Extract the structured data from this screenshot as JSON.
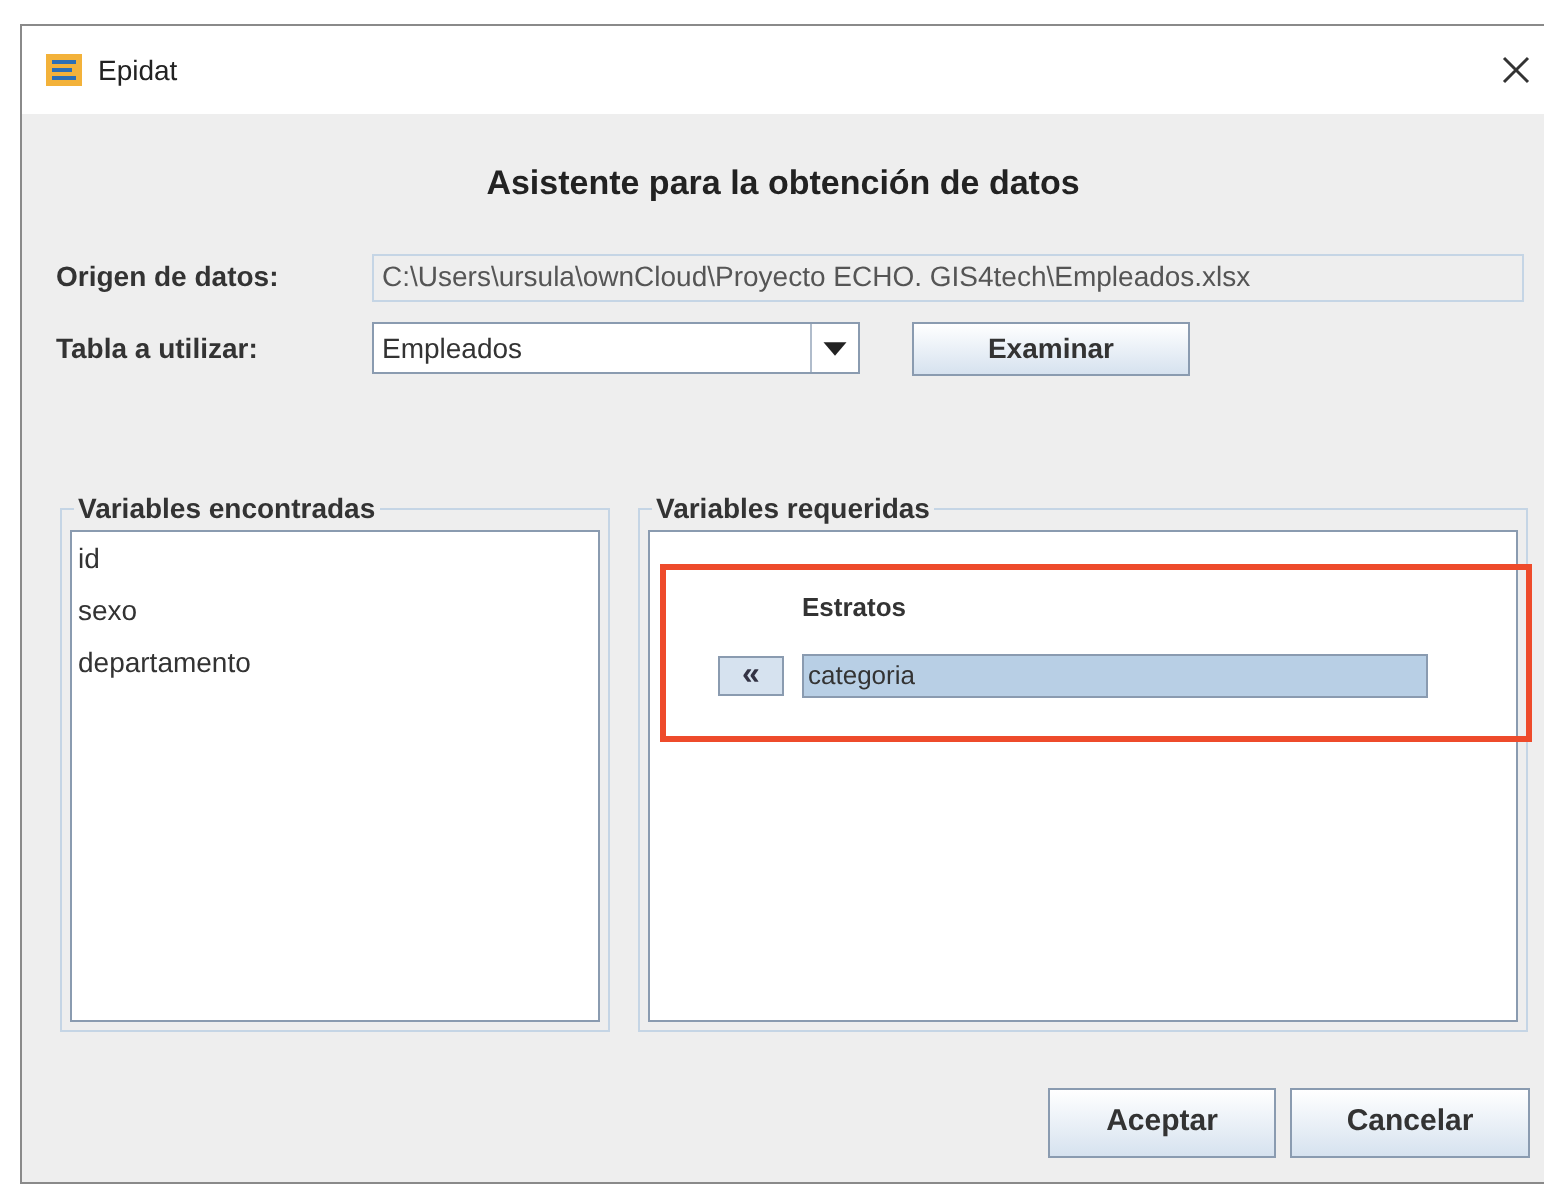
{
  "window": {
    "title": "Epidat"
  },
  "heading": "Asistente para la obtención de datos",
  "origin": {
    "label": "Origen de datos:",
    "value": "C:\\Users\\ursula\\ownCloud\\Proyecto ECHO. GIS4tech\\Empleados.xlsx"
  },
  "table": {
    "label": "Tabla a utilizar:",
    "value": "Empleados",
    "browse_button": "Examinar"
  },
  "found": {
    "title": "Variables encontradas",
    "items": [
      "id",
      "sexo",
      "departamento"
    ]
  },
  "required": {
    "title": "Variables requeridas",
    "fields": [
      {
        "label": "Estratos",
        "value": "categoria",
        "button": "«"
      }
    ]
  },
  "buttons": [
    "Aceptar",
    "Cancelar"
  ]
}
